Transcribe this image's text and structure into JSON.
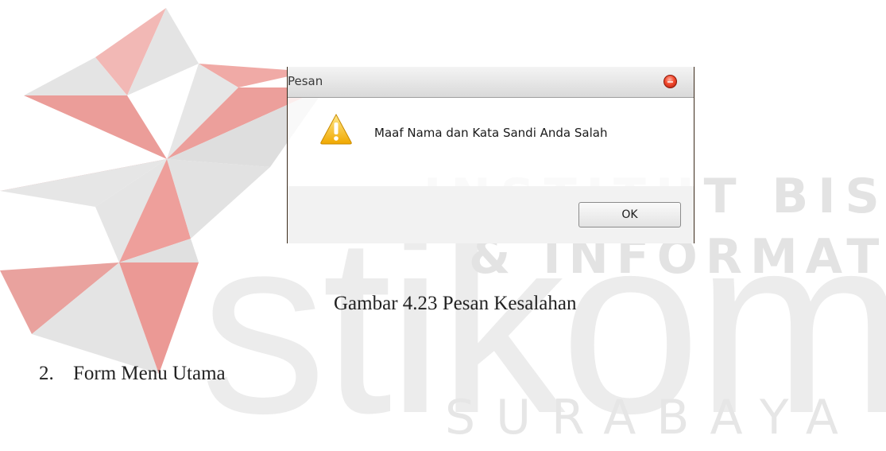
{
  "watermark": {
    "institute_line1": "INSTITUT BISNIS",
    "institute_line2": "& INFORMATIKA",
    "brand": "stikom",
    "city": "SURABAYA"
  },
  "dialog": {
    "title": "Pesan",
    "message": "Maaf Nama dan Kata Sandi Anda Salah",
    "ok_label": "OK",
    "icon": "warning-icon",
    "close_icon": "close-icon"
  },
  "caption": "Gambar 4.23 Pesan Kesalahan",
  "list_item": {
    "number": "2.",
    "text": "Form Menu Utama"
  },
  "colors": {
    "logo_red": "#e88a86",
    "logo_gray": "#dcdcdc",
    "watermark_text": "#ececec",
    "close_button": "#f24a2e",
    "warning_yellow": "#f7c21a"
  }
}
